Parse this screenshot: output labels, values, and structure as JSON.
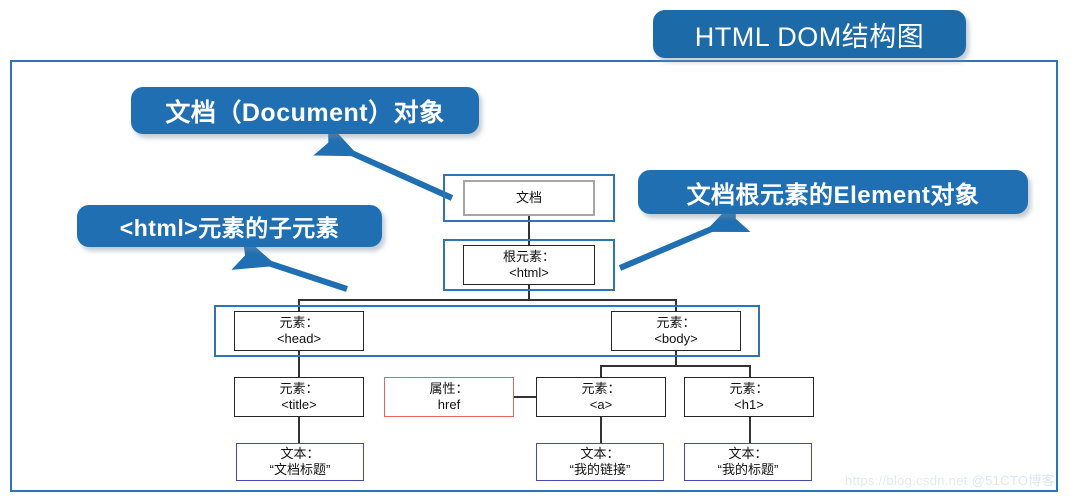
{
  "diagram": {
    "title": "HTML DOM结构图",
    "callouts": [
      {
        "id": "document-object",
        "label": "文档（Document）对象"
      },
      {
        "id": "root-element-object",
        "label": "文档根元素的Element对象"
      },
      {
        "id": "html-child-elements",
        "label": "<html>元素的子元素"
      }
    ],
    "nodes": [
      {
        "id": "document",
        "line1": "文档",
        "line2": "",
        "border": "#a6a6a6"
      },
      {
        "id": "root-html",
        "line1": "根元素：",
        "line2": "<html>",
        "border": "#262626"
      },
      {
        "id": "head",
        "line1": "元素：",
        "line2": "<head>",
        "border": "#262626"
      },
      {
        "id": "body",
        "line1": "元素：",
        "line2": "<body>",
        "border": "#262626"
      },
      {
        "id": "title",
        "line1": "元素：",
        "line2": "<title>",
        "border": "#262626"
      },
      {
        "id": "attr-href",
        "line1": "属性：",
        "line2": "href",
        "border": "#e06666"
      },
      {
        "id": "anchor",
        "line1": "元素：",
        "line2": "<a>",
        "border": "#262626"
      },
      {
        "id": "heading1",
        "line1": "元素：",
        "line2": "<h1>",
        "border": "#262626"
      },
      {
        "id": "text-title",
        "line1": "文本：",
        "line2": "“文档标题”",
        "border": "#4a4ab5"
      },
      {
        "id": "text-link",
        "line1": "文本：",
        "line2": "“我的链接”",
        "border": "#4a4ab5"
      },
      {
        "id": "text-heading",
        "line1": "文本：",
        "line2": "“我的标题”",
        "border": "#4a4ab5"
      }
    ],
    "colors": {
      "accent_blue": "#1f6fb2",
      "frame_blue": "#2e75b6",
      "node_gray": "#a6a6a6",
      "node_black": "#262626",
      "attr_red": "#e06666",
      "text_node_blue": "#4a4ab5"
    },
    "watermark": {
      "url": "https://blog.csdn.net",
      "source": "@51CTO博客"
    }
  }
}
